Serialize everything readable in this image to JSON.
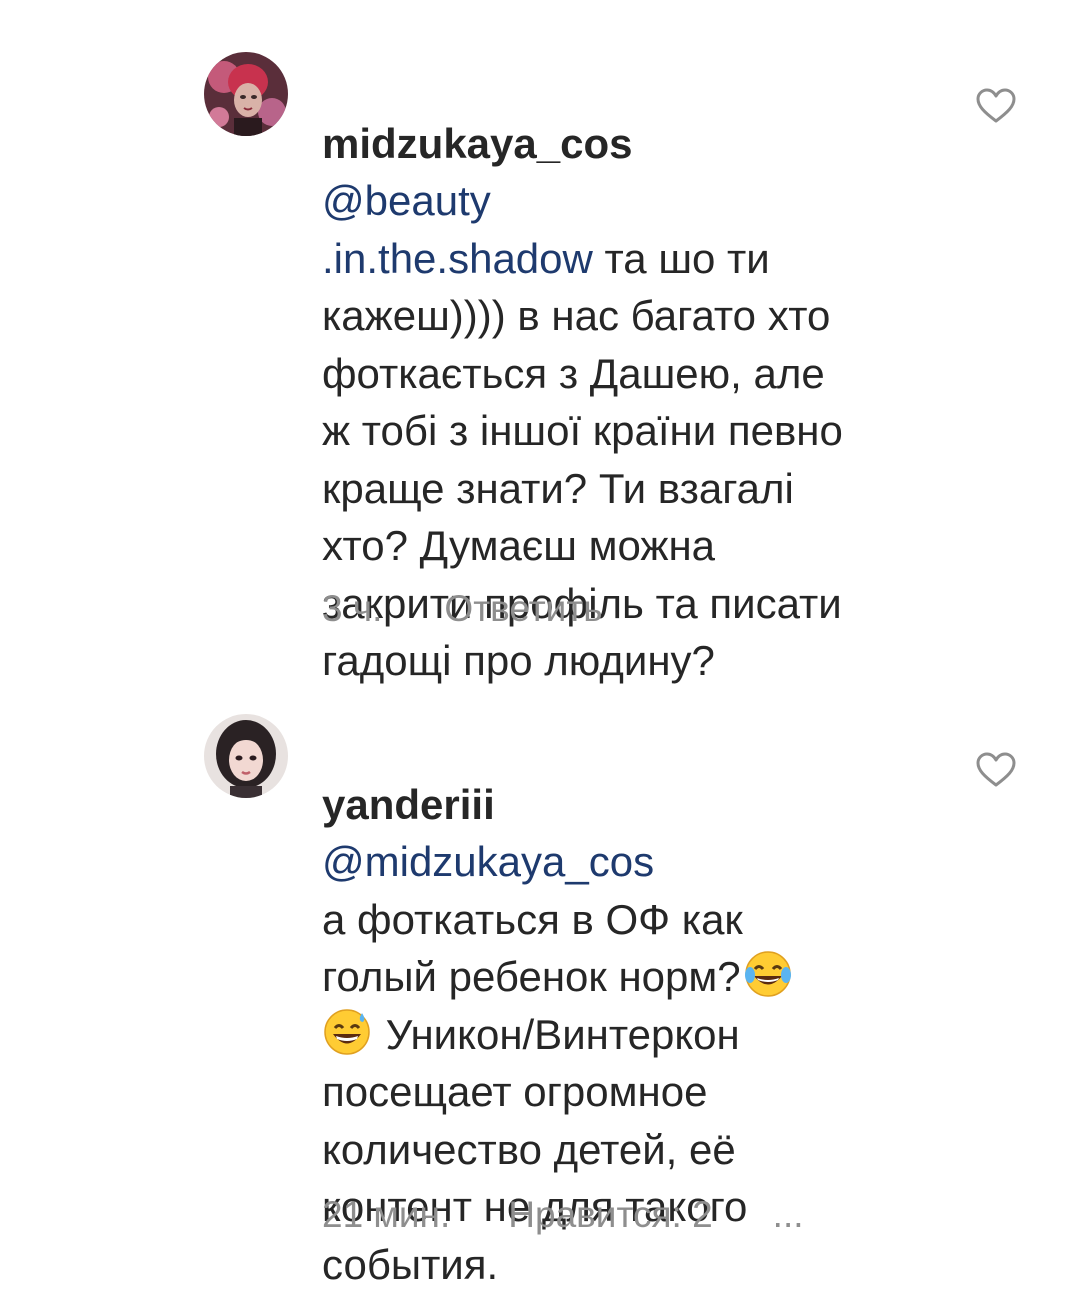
{
  "comments": [
    {
      "username": "midzukaya_cos",
      "mention_part1": "@beauty",
      "mention_part2": ".in.the.shadow",
      "text_after_mention": " та шо ти\nкажеш)))) в нас багато хто\nфоткається з Дашею, але\nж тобі з іншої країни певно\nкраще знати? Ти взагалі\nхто? Думаєш можна\nзакрити профіль та писати\nгадощі про людину?",
      "time": "3 ч.",
      "reply_label": "Ответить",
      "like_icon": "heart-outline-icon"
    },
    {
      "username": "yanderiii",
      "mention": "@midzukaya_cos",
      "text_line1": "а фоткаться в ОФ как",
      "text_line2": "голый ребенок норм?",
      "emoji1": "face-with-tears-of-joy-icon",
      "emoji2": "grinning-face-with-sweat-icon",
      "text_rest_after_emoji": " Уникон/Винтеркон\nпосещает огромное\nколичество детей, её\nконтент не для такого\nсобытия.",
      "time": "21 мин.",
      "likes_label": "Нравится: 2",
      "more_label": "...",
      "like_icon": "heart-outline-icon"
    }
  ],
  "colors": {
    "text": "#262626",
    "mention": "#1e3a6e",
    "meta": "#8e8e8e"
  }
}
